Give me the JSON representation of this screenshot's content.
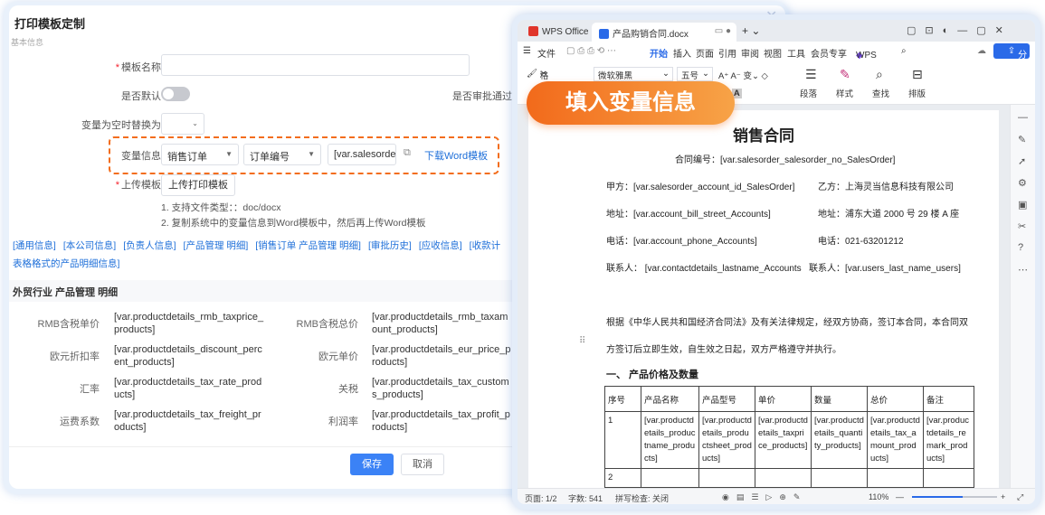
{
  "left": {
    "title": "打印模板定制",
    "subtitle": "基本信息",
    "form": {
      "template_name_label": "模板名称",
      "is_default_label": "是否默认",
      "approval_label": "是否审批通过后",
      "empty_replace_label": "变量为空时替换为",
      "variable_label": "变量信息",
      "variable_select1": "销售订单",
      "variable_select2": "订单编号",
      "variable_value": "[var.salesorder",
      "download_link": "下载Word模板",
      "upload_label": "上传模板",
      "upload_button": "上传打印模板",
      "tip1": "1. 支持文件类型：：doc/docx",
      "tip2": "2. 复制系统中的变量信息到Word模板中，然后再上传Word模板"
    },
    "links": [
      "[通用信息]",
      "[本公司信息]",
      "[负责人信息]",
      "[产品管理 明细]",
      "[销售订单 产品管理 明细]",
      "[审批历史]",
      "[应收信息]",
      "[收款计",
      "表格格式的产品明细信息]"
    ],
    "section_title": "外贸行业 产品管理 明细",
    "fields": [
      {
        "label": "RMB含税单价",
        "value": "[var.productdetails_rmb_taxprice_products]",
        "label2": "RMB含税总价",
        "value2": "[var.productdetails_rmb_taxamount_products]"
      },
      {
        "label": "欧元折扣率",
        "value": "[var.productdetails_discount_percent_products]",
        "label2": "欧元单价",
        "value2": "[var.productdetails_eur_price_products]"
      },
      {
        "label": "汇率",
        "value": "[var.productdetails_tax_rate_products]",
        "label2": "关税",
        "value2": "[var.productdetails_tax_customs_products]"
      },
      {
        "label": "运费系数",
        "value": "[var.productdetails_tax_freight_products]",
        "label2": "利润率",
        "value2": "[var.productdetails_tax_profit_products]"
      }
    ],
    "save_button": "保存",
    "cancel_button": "取消"
  },
  "badge": "填入变量信息",
  "wps": {
    "tabs": [
      "WPS Office",
      "产品购销合同.docx"
    ],
    "menu": [
      "文件",
      "开始",
      "插入",
      "页面",
      "引用",
      "审阅",
      "视图",
      "工具",
      "会员专享",
      "WPS AI"
    ],
    "share": "分享",
    "ribbon": {
      "format_painter": "格式刷",
      "font": "微软雅黑",
      "size": "五号",
      "paragraph": "段落",
      "style": "样式",
      "find": "查找",
      "layout": "排版"
    },
    "doc": {
      "title": "销售合同",
      "contract_no": "合同编号：[var.salesorder_salesorder_no_SalesOrder]",
      "party_a": "甲方：[var.salesorder_account_id_SalesOrder]",
      "party_b": "乙方：上海灵当信息科技有限公司",
      "addr_a": "地址：[var.account_bill_street_Accounts]",
      "addr_b": "地址：浦东大道 2000 号 29 楼 A 座",
      "phone_a": "电话：[var.account_phone_Accounts]",
      "phone_b": "电话：021-63201212",
      "contact_a": "联系人：  [var.contactdetails_lastname_Accounts",
      "contact_b": "联系人：[var.users_last_name_users]",
      "para1": "根据《中华人民共和国经济合同法》及有关法律规定，经双方协商，签订本合同，本合同双",
      "para2": "方签订后立即生效，自生效之日起，双方严格遵守并执行。",
      "section": "一、  产品价格及数量",
      "table_headers": [
        "序号",
        "产品名称",
        "产品型号",
        "单价",
        "数量",
        "总价",
        "备注"
      ],
      "table_row1": [
        "1",
        "[var.productdetails_productname_products]",
        "[var.productdetails_productsheet_products]",
        "[var.productdetails_taxprice_products]",
        "[var.productdetails_quantity_products]",
        "[var.productdetails_tax_amount_products]",
        "[var.productdetails_remark_products]"
      ],
      "table_row2_index": "2"
    },
    "status": {
      "page": "页面: 1/2",
      "words": "字数: 541",
      "spell": "拼写检查: 关闭",
      "zoom": "110%"
    }
  }
}
